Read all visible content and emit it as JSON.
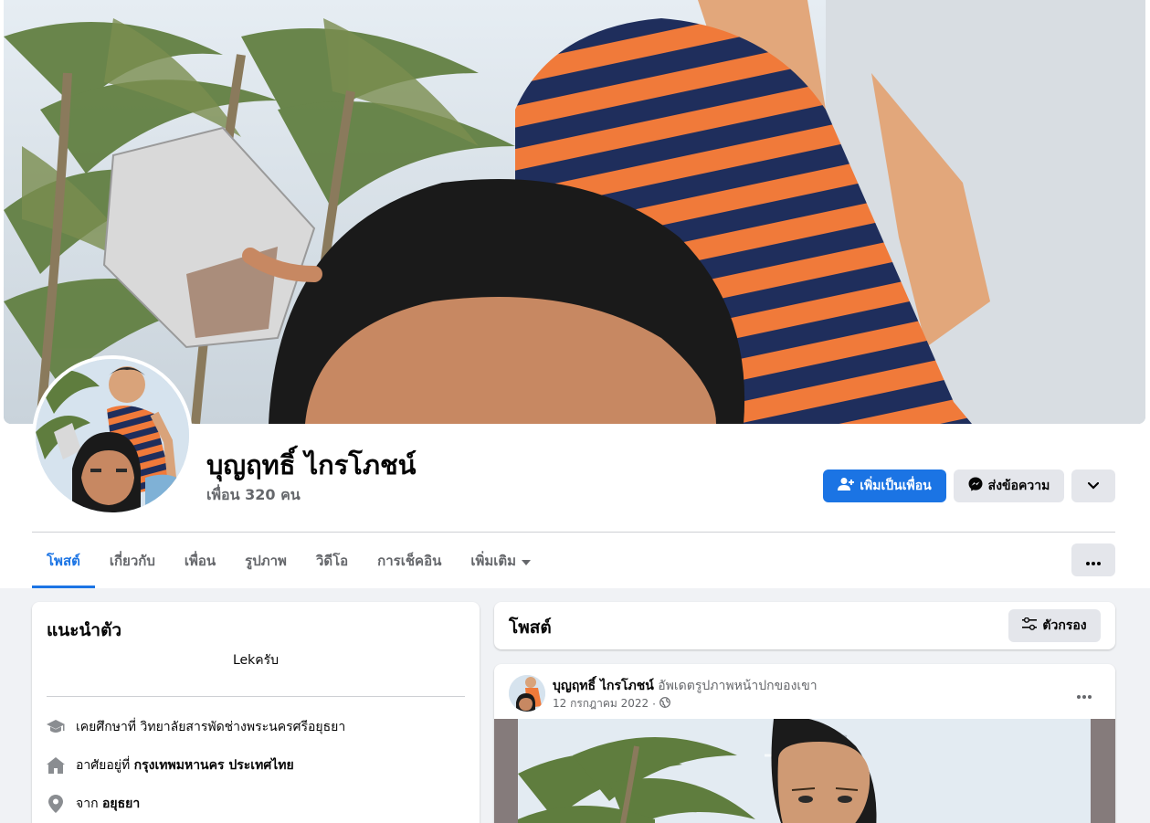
{
  "profile": {
    "name": "บุญฤทธิ์ ไกรโภชน์",
    "friends": "เพื่อน 320 คน"
  },
  "actions": {
    "add_friend": "เพิ่มเป็นเพื่อน",
    "message": "ส่งข้อความ"
  },
  "tabs": [
    {
      "label": "โพสต์",
      "active": true
    },
    {
      "label": "เกี่ยวกับ",
      "active": false
    },
    {
      "label": "เพื่อน",
      "active": false
    },
    {
      "label": "รูปภาพ",
      "active": false
    },
    {
      "label": "วิดีโอ",
      "active": false
    },
    {
      "label": "การเช็คอิน",
      "active": false
    },
    {
      "label": "เพิ่มเติม",
      "active": false
    }
  ],
  "intro": {
    "title": "แนะนำตัว",
    "bio": "Lekครับ",
    "education_prefix": "เคยศึกษาที่ ",
    "education_value": "วิทยาลัยสารพัดช่างพระนครศรีอยุธยา",
    "lives_prefix": "อาศัยอยู่ที่ ",
    "lives_value": "กรุงเทพมหานคร ประเทศไทย",
    "from_prefix": "จาก ",
    "from_value": "อยุธยา"
  },
  "posts": {
    "title": "โพสต์",
    "filter_label": "ตัวกรอง"
  },
  "post": {
    "author": "บุญฤทธิ์ ไกรโภชน์",
    "action": " อัพเดตรูปภาพหน้าปกของเขา",
    "date": "12 กรกฎาคม 2022",
    "separator": "·"
  },
  "colors": {
    "accent": "#1b74e4",
    "background": "#f0f2f5",
    "secondary_button": "#e4e6eb",
    "muted_text": "#65676b"
  },
  "icons": {
    "add_friend": "person-plus-icon",
    "message": "messenger-icon",
    "dropdown": "chevron-down-icon",
    "more": "ellipsis-icon",
    "filter": "sliders-icon",
    "education": "graduation-cap-icon",
    "home": "home-icon",
    "location": "location-pin-icon",
    "privacy": "globe-icon"
  }
}
